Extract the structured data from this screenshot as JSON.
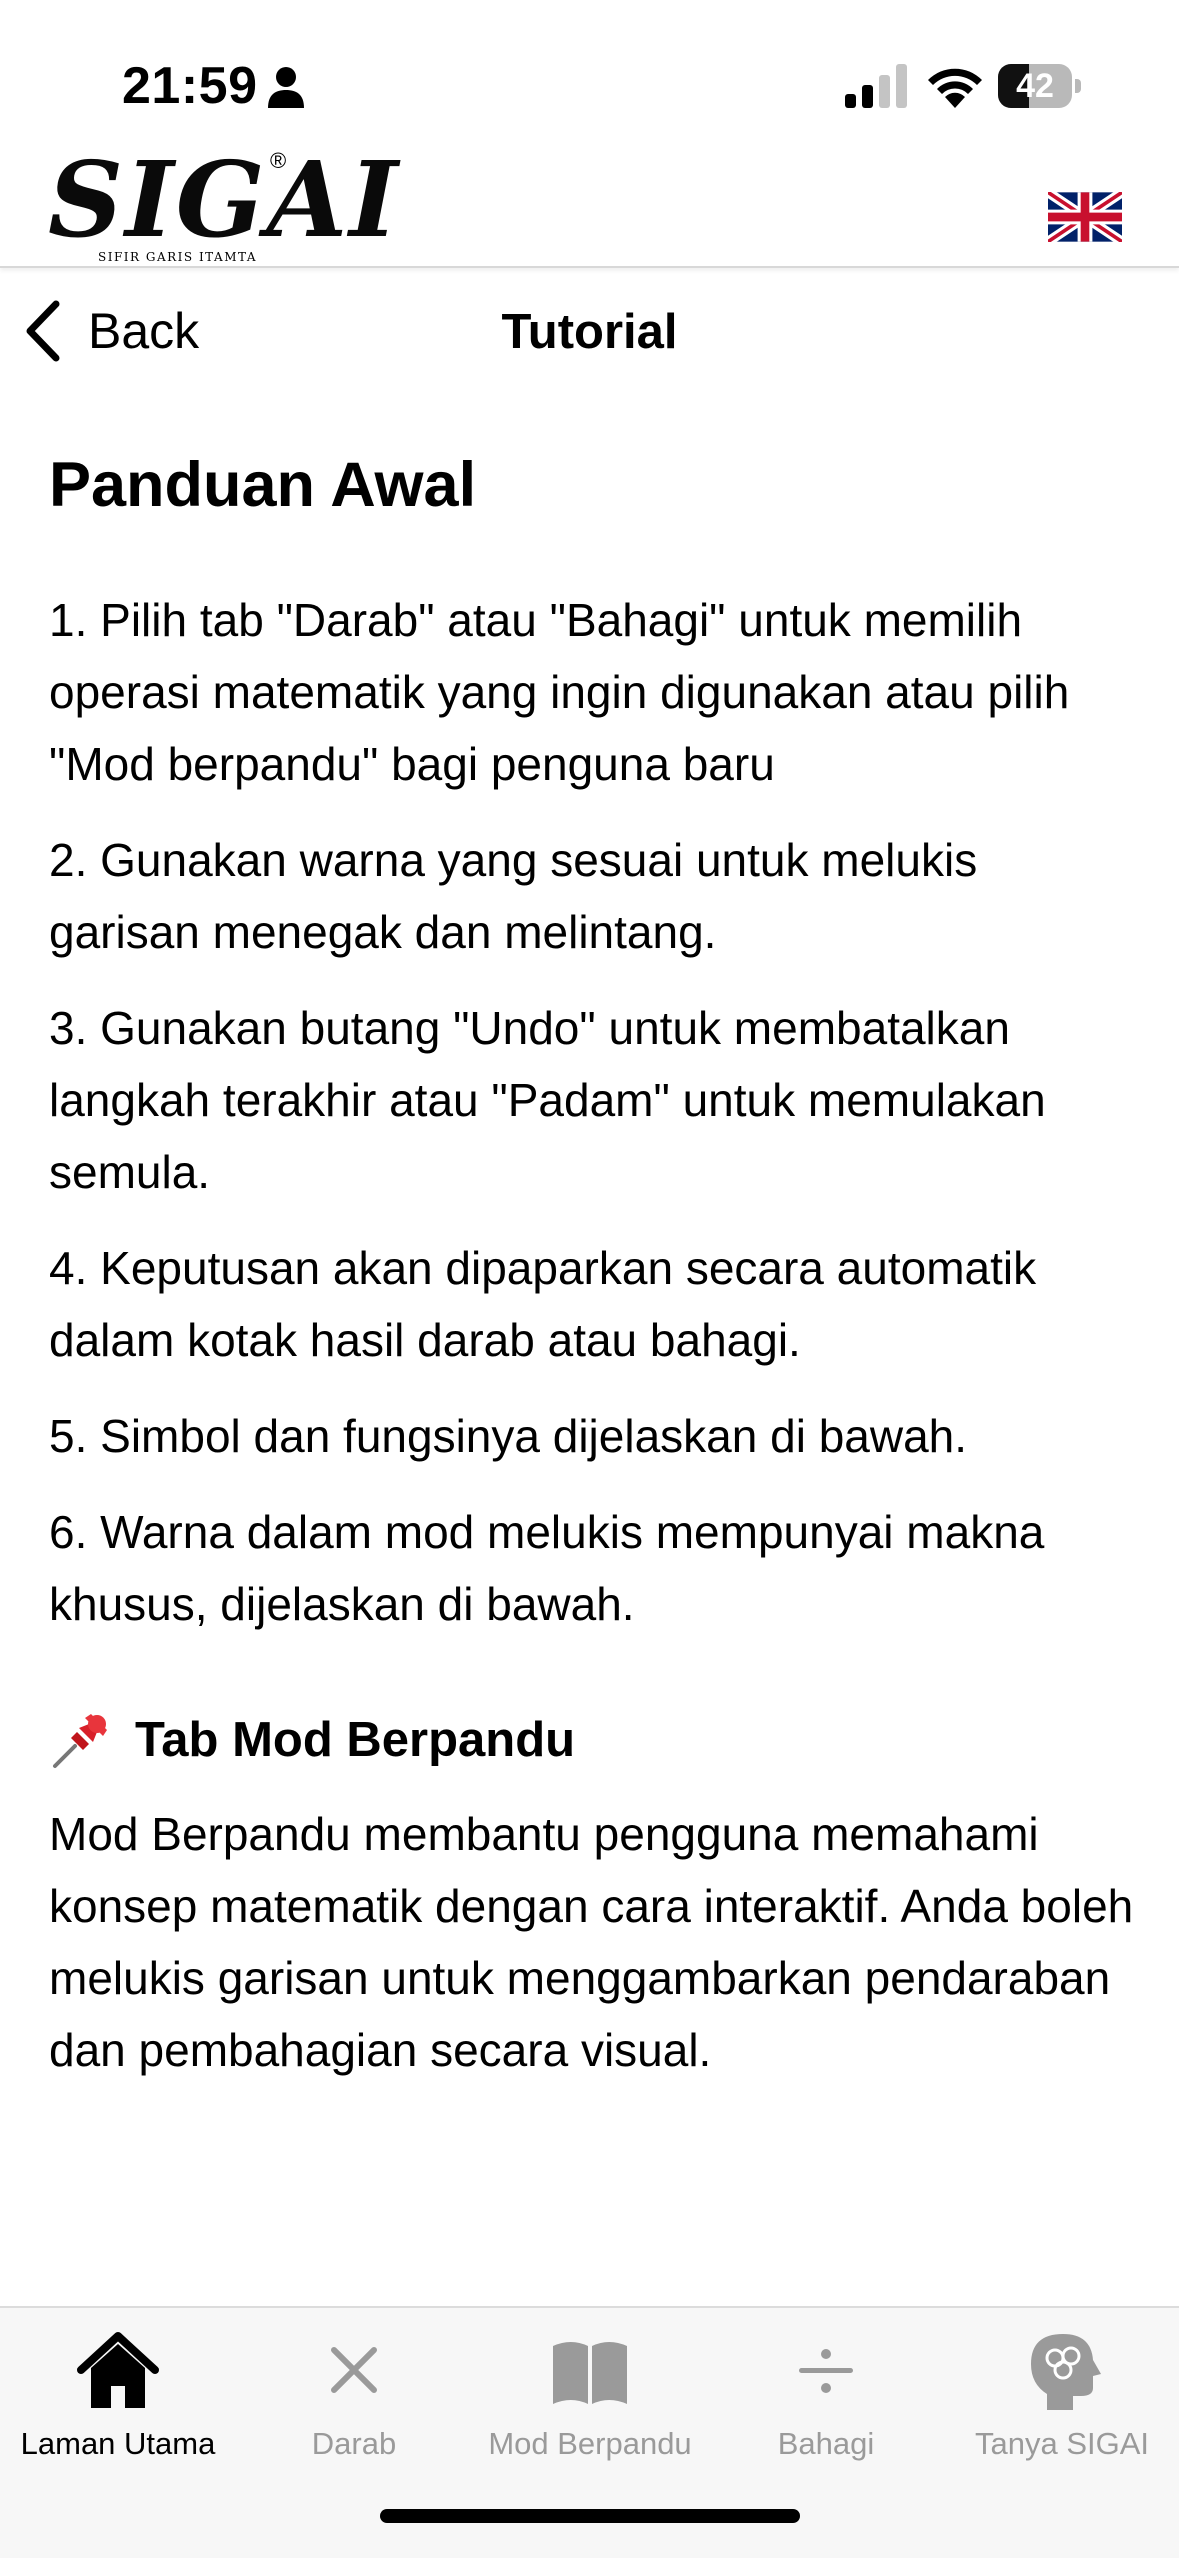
{
  "status_bar": {
    "time": "21:59",
    "battery": "42",
    "battery_level": 0.42,
    "icons": [
      "person-icon",
      "signal-icon",
      "wifi-icon",
      "battery-icon"
    ]
  },
  "header": {
    "logo": "SIGAI",
    "logo_reg": "®",
    "logo_sub": "SIFIR GARIS ITAMTA",
    "language_flag": "uk-flag-icon"
  },
  "nav": {
    "back_label": "Back",
    "title": "Tutorial"
  },
  "content": {
    "heading": "Panduan Awal",
    "steps": [
      "1. Pilih tab \"Darab\" atau \"Bahagi\" untuk memilih operasi matematik yang ingin digunakan atau pilih \"Mod berpandu\" bagi penguna baru",
      "2. Gunakan warna yang sesuai untuk melukis garisan menegak dan melintang.",
      "3. Gunakan butang \"Undo\" untuk membatalkan langkah terakhir atau \"Padam\" untuk memulakan semula.",
      "4. Keputusan akan dipaparkan secara automatik dalam kotak hasil darab atau bahagi.",
      "5. Simbol dan fungsinya dijelaskan di bawah.",
      "6. Warna dalam mod melukis mempunyai makna khusus, dijelaskan di bawah."
    ],
    "section": {
      "icon": "pin-icon",
      "title": "Tab Mod Berpandu",
      "body": "Mod Berpandu membantu pengguna memahami konsep matematik dengan cara interaktif. Anda boleh melukis garisan untuk menggambarkan pendaraban dan pembahagian secara visual."
    }
  },
  "tabs": [
    {
      "label": "Laman Utama",
      "icon": "home-icon",
      "active": true
    },
    {
      "label": "Darab",
      "icon": "multiply-icon",
      "active": false
    },
    {
      "label": "Mod Berpandu",
      "icon": "book-icon",
      "active": false
    },
    {
      "label": "Bahagi",
      "icon": "divide-icon",
      "active": false
    },
    {
      "label": "Tanya SIGAI",
      "icon": "brain-head-icon",
      "active": false
    }
  ],
  "colors": {
    "active_tab": "#000000",
    "inactive_tab": "#9a9a9a",
    "tab_bar_bg": "#f7f7f7"
  }
}
